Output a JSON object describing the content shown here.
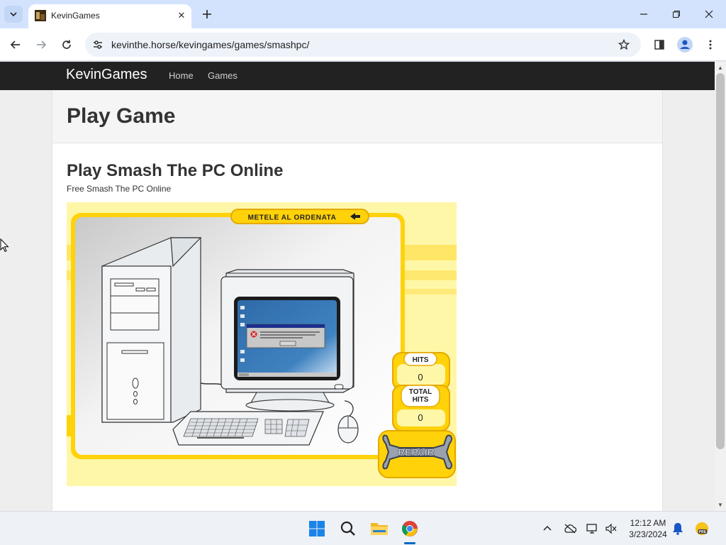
{
  "browser": {
    "tab_title": "KevinGames",
    "tab_close": "✕",
    "new_tab": "+",
    "url": "kevinthe.horse/kevingames/games/smashpc/"
  },
  "site": {
    "brand": "KevinGames",
    "nav": [
      "Home",
      "Games"
    ]
  },
  "page": {
    "header_title": "Play Game",
    "game_title": "Play Smash The PC Online",
    "game_subtitle": "Free Smash The PC Online"
  },
  "game": {
    "banner": "METELE AL ORDENATA",
    "hits_label": "HITS",
    "hits_value": "0",
    "total_hits_label_1": "TOTAL",
    "total_hits_label_2": "HITS",
    "total_hits_value": "0",
    "repair_label": "REPAIR"
  },
  "taskbar": {
    "time": "12:12 AM",
    "date": "3/23/2024"
  },
  "colors": {
    "nav_bg": "#222222",
    "game_yellow": "#ffd20a",
    "game_pale": "#fff7a8",
    "screen_blue": "#3a78b5"
  }
}
